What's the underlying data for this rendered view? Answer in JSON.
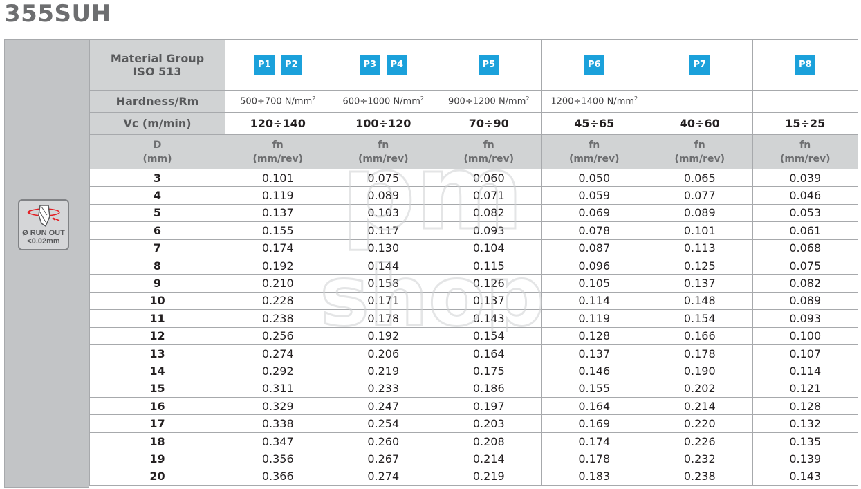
{
  "title": "355SUH",
  "runout": {
    "line1": "Ø RUN OUT",
    "line2": "<0.02mm",
    "icon": "drill-runout-icon"
  },
  "header": {
    "material_group_line1": "Material Group",
    "material_group_line2": "ISO 513",
    "hardness_label": "Hardness/Rm",
    "vc_label": "Vc (m/min)",
    "d_label_line1": "D",
    "d_label_line2": "(mm)"
  },
  "columns": [
    {
      "badges": [
        "P1",
        "P2"
      ],
      "hardness": "500÷700 N/mm",
      "hardness_sup": "2",
      "vc": "120÷140",
      "fn_line1": "fn",
      "fn_line2": "(mm/rev)"
    },
    {
      "badges": [
        "P3",
        "P4"
      ],
      "hardness": "600÷1000 N/mm",
      "hardness_sup": "2",
      "vc": "100÷120",
      "fn_line1": "fn",
      "fn_line2": "(mm/rev)"
    },
    {
      "badges": [
        "P5"
      ],
      "hardness": "900÷1200 N/mm",
      "hardness_sup": "2",
      "vc": "70÷90",
      "fn_line1": "fn",
      "fn_line2": "(mm/rev)"
    },
    {
      "badges": [
        "P6"
      ],
      "hardness": "1200÷1400 N/mm",
      "hardness_sup": "2",
      "vc": "45÷65",
      "fn_line1": "fn",
      "fn_line2": "(mm/rev)"
    },
    {
      "badges": [
        "P7"
      ],
      "hardness": "",
      "hardness_sup": "",
      "vc": "40÷60",
      "fn_line1": "fn",
      "fn_line2": "(mm/rev)"
    },
    {
      "badges": [
        "P8"
      ],
      "hardness": "",
      "hardness_sup": "",
      "vc": "15÷25",
      "fn_line1": "fn",
      "fn_line2": "(mm/rev)"
    }
  ],
  "rows": [
    {
      "d": "3",
      "v": [
        "0.101",
        "0.075",
        "0.060",
        "0.050",
        "0.065",
        "0.039"
      ]
    },
    {
      "d": "4",
      "v": [
        "0.119",
        "0.089",
        "0.071",
        "0.059",
        "0.077",
        "0.046"
      ]
    },
    {
      "d": "5",
      "v": [
        "0.137",
        "0.103",
        "0.082",
        "0.069",
        "0.089",
        "0.053"
      ]
    },
    {
      "d": "6",
      "v": [
        "0.155",
        "0.117",
        "0.093",
        "0.078",
        "0.101",
        "0.061"
      ]
    },
    {
      "d": "7",
      "v": [
        "0.174",
        "0.130",
        "0.104",
        "0.087",
        "0.113",
        "0.068"
      ]
    },
    {
      "d": "8",
      "v": [
        "0.192",
        "0.144",
        "0.115",
        "0.096",
        "0.125",
        "0.075"
      ]
    },
    {
      "d": "9",
      "v": [
        "0.210",
        "0.158",
        "0.126",
        "0.105",
        "0.137",
        "0.082"
      ]
    },
    {
      "d": "10",
      "v": [
        "0.228",
        "0.171",
        "0.137",
        "0.114",
        "0.148",
        "0.089"
      ]
    },
    {
      "d": "11",
      "v": [
        "0.238",
        "0.178",
        "0.143",
        "0.119",
        "0.154",
        "0.093"
      ]
    },
    {
      "d": "12",
      "v": [
        "0.256",
        "0.192",
        "0.154",
        "0.128",
        "0.166",
        "0.100"
      ]
    },
    {
      "d": "13",
      "v": [
        "0.274",
        "0.206",
        "0.164",
        "0.137",
        "0.178",
        "0.107"
      ]
    },
    {
      "d": "14",
      "v": [
        "0.292",
        "0.219",
        "0.175",
        "0.146",
        "0.190",
        "0.114"
      ]
    },
    {
      "d": "15",
      "v": [
        "0.311",
        "0.233",
        "0.186",
        "0.155",
        "0.202",
        "0.121"
      ]
    },
    {
      "d": "16",
      "v": [
        "0.329",
        "0.247",
        "0.197",
        "0.164",
        "0.214",
        "0.128"
      ]
    },
    {
      "d": "17",
      "v": [
        "0.338",
        "0.254",
        "0.203",
        "0.169",
        "0.220",
        "0.132"
      ]
    },
    {
      "d": "18",
      "v": [
        "0.347",
        "0.260",
        "0.208",
        "0.174",
        "0.226",
        "0.135"
      ]
    },
    {
      "d": "19",
      "v": [
        "0.356",
        "0.267",
        "0.214",
        "0.178",
        "0.232",
        "0.139"
      ]
    },
    {
      "d": "20",
      "v": [
        "0.366",
        "0.274",
        "0.219",
        "0.183",
        "0.238",
        "0.143"
      ]
    }
  ],
  "watermark": {
    "line1": "pm",
    "line2": "shop"
  },
  "colors": {
    "badge": "#1ba1db",
    "header_bg": "#d1d3d4",
    "sidebar_bg": "#c2c4c6",
    "title": "#6d6e70"
  }
}
